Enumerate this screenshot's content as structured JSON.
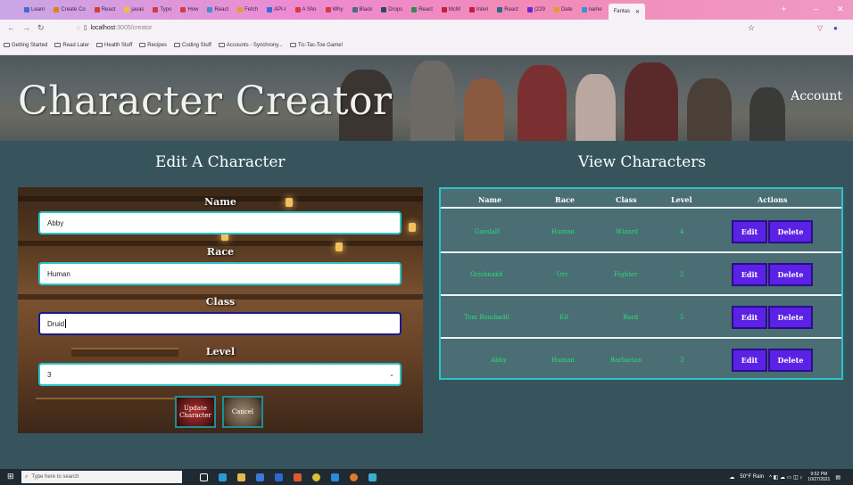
{
  "browser": {
    "tabs": [
      {
        "label": "Learn",
        "color": "#3b6fd6"
      },
      {
        "label": "Create Co",
        "color": "#e08020"
      },
      {
        "label": "React",
        "color": "#d43c3c"
      },
      {
        "label": "javas",
        "color": "#f2c032"
      },
      {
        "label": "Typo",
        "color": "#d43c3c"
      },
      {
        "label": "How",
        "color": "#d43c3c"
      },
      {
        "label": "React",
        "color": "#3a8fd6"
      },
      {
        "label": "Fetch",
        "color": "#e0a020"
      },
      {
        "label": "API-I",
        "color": "#2f6fd0"
      },
      {
        "label": "A Sho",
        "color": "#d43c3c"
      },
      {
        "label": "Why",
        "color": "#d43c3c"
      },
      {
        "label": "Black",
        "color": "#4a6a8a"
      },
      {
        "label": "Drops",
        "color": "#2a4a6a"
      },
      {
        "label": "React",
        "color": "#2e8b57"
      },
      {
        "label": "McM",
        "color": "#c02040"
      },
      {
        "label": "Interi",
        "color": "#c02040"
      },
      {
        "label": "React",
        "color": "#2a6a8a"
      },
      {
        "label": "(229",
        "color": "#6a2ad0"
      },
      {
        "label": "Date",
        "color": "#e0a020"
      },
      {
        "label": "name",
        "color": "#3a8fd6"
      }
    ],
    "active_tab": "Fantas",
    "url_host": "localhost",
    "url_path": ":3005/creator",
    "bookmarks": [
      "Getting Started",
      "Read Later",
      "Health Stuff",
      "Recipes",
      "Coding Stuff",
      "Accounts - Synchrony...",
      "Tic-Tac-Toe Game!"
    ]
  },
  "header": {
    "title": "Character Creator",
    "account": "Account"
  },
  "edit": {
    "title": "Edit A Character",
    "name_label": "Name",
    "name_value": "Abby",
    "race_label": "Race",
    "race_value": "Human",
    "class_label": "Class",
    "class_value": "Druid",
    "level_label": "Level",
    "level_value": "3",
    "update_button": "Update Character",
    "cancel_button": "Cancel"
  },
  "view": {
    "title": "View Characters",
    "columns": [
      "Name",
      "Race",
      "Class",
      "Level",
      "Actions"
    ],
    "rows": [
      {
        "name": "Gandalf",
        "race": "Human",
        "class": "Wizard",
        "level": "4"
      },
      {
        "name": "Grishnakh",
        "race": "Orc",
        "class": "Fighter",
        "level": "2"
      },
      {
        "name": "Tom Bombadil",
        "race": "Elf",
        "class": "Bard",
        "level": "5"
      },
      {
        "name": "Abby",
        "race": "Human",
        "class": "Barbarian",
        "level": "3"
      }
    ],
    "edit_label": "Edit",
    "delete_label": "Delete"
  },
  "taskbar": {
    "search_placeholder": "Type here to search",
    "weather": "50°F Rain",
    "time": "9:52 PM",
    "date": "10/27/2021"
  }
}
